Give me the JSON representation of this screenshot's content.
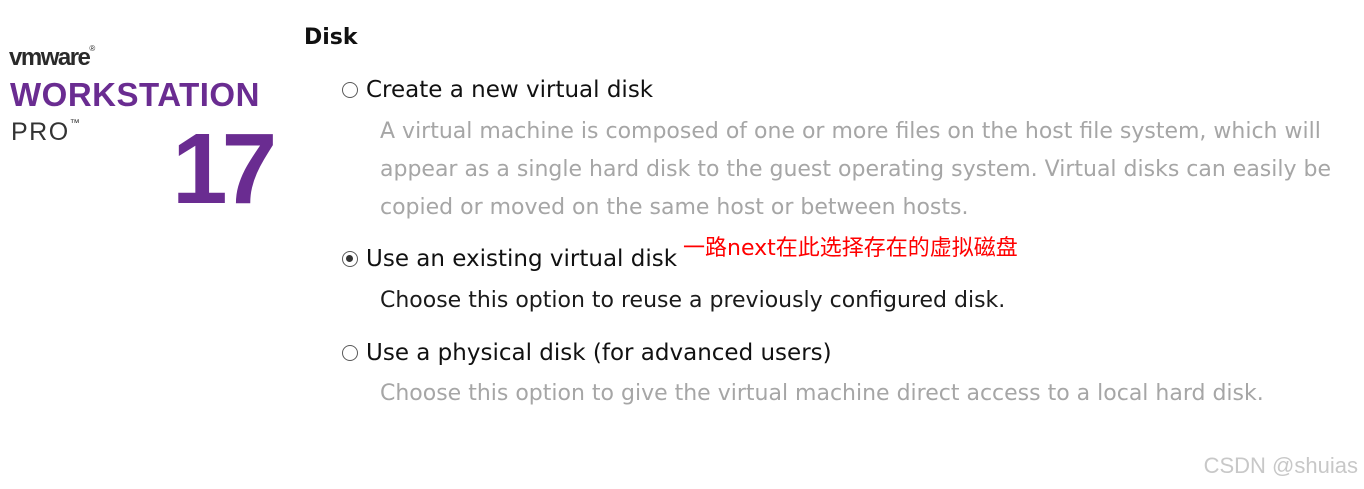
{
  "brand": {
    "vendor": "vmware",
    "vendor_mark": "®",
    "product": "WORKSTATION",
    "edition": "PRO",
    "edition_mark": "™",
    "version": "17",
    "color": "#6a2c91"
  },
  "section": {
    "title": "Disk"
  },
  "options": [
    {
      "label": "Create a new virtual disk",
      "selected": false,
      "description": "A virtual machine is composed of one or more files on the host file system, which will appear as a single hard disk to the guest operating system. Virtual disks can easily be copied or moved on the same host or between hosts."
    },
    {
      "label": "Use an existing virtual disk",
      "selected": true,
      "description": "Choose this option to reuse a previously configured disk."
    },
    {
      "label": "Use a physical disk (for advanced users)",
      "selected": false,
      "description": "Choose this option to give the virtual machine direct access to a local hard disk."
    }
  ],
  "annotation": {
    "text": "一路next在此选择存在的虚拟磁盘",
    "color": "#ff0000"
  },
  "watermark": {
    "text": "CSDN @shuias"
  }
}
